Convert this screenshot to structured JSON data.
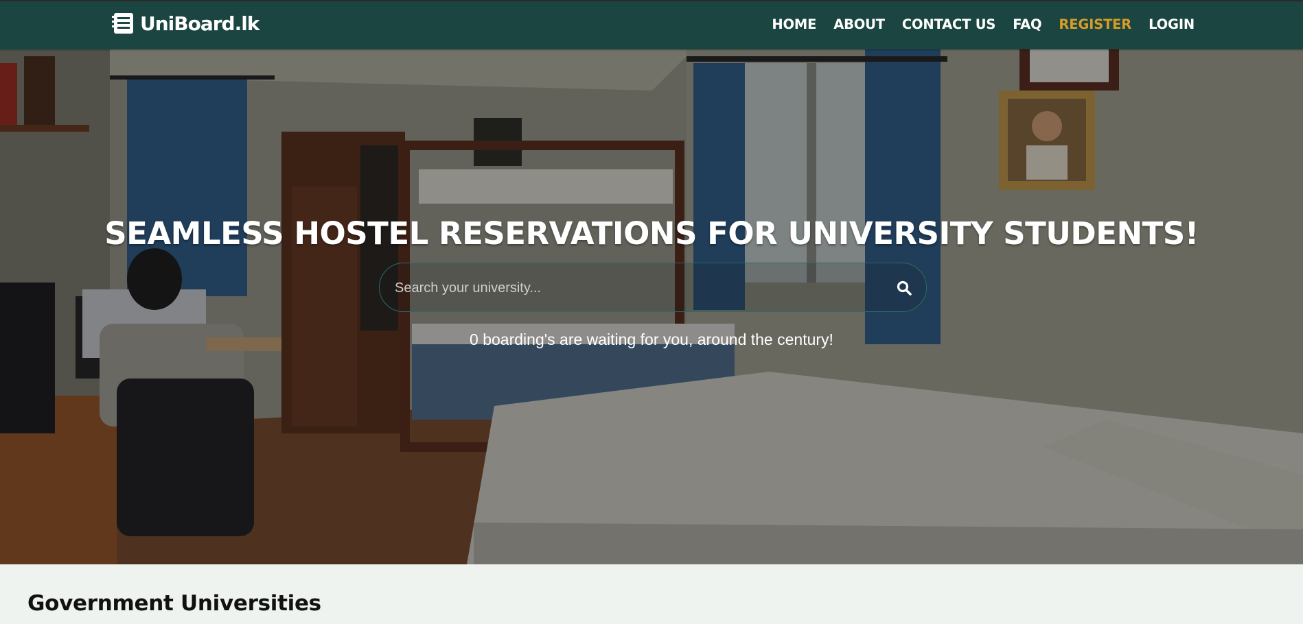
{
  "brand": {
    "name": "UniBoard.lk"
  },
  "nav": {
    "home": "HOME",
    "about": "ABOUT",
    "contact": "CONTACT US",
    "faq": "FAQ",
    "register": "REGISTER",
    "login": "LOGIN"
  },
  "hero": {
    "headline": "SEAMLESS HOSTEL RESERVATIONS FOR UNIVERSITY STUDENTS!",
    "search_placeholder": "Search your university...",
    "tagline": "0 boarding's are waiting for you, around the century!"
  },
  "section": {
    "title": "Government Universities"
  },
  "colors": {
    "navbar": "#1b4540",
    "accent": "#d79d27",
    "page_bg": "#eef3ef"
  },
  "icons": [
    "logo-icon",
    "search-icon"
  ]
}
